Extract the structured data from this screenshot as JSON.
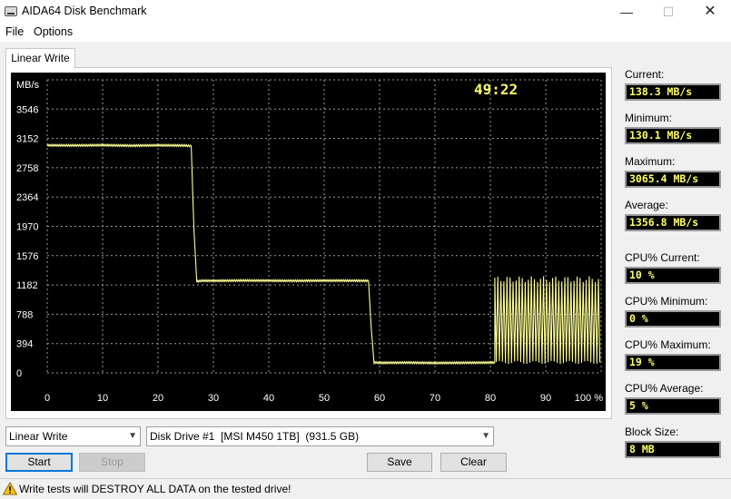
{
  "window": {
    "title": "AIDA64 Disk Benchmark",
    "minimize_glyph": "—",
    "maximize_glyph": "☐",
    "close_glyph": "✕",
    "icon": "disk-benchmark-icon"
  },
  "menu": {
    "file": "File",
    "options": "Options"
  },
  "tab": {
    "label": "Linear Write"
  },
  "chart": {
    "timer": "49:22",
    "ylabel": "MB/s",
    "timer_color": "#ffff66",
    "line_color": "#ffff99",
    "grid_color": "#9a9a9a",
    "background": "#000000"
  },
  "chart_data": {
    "type": "line",
    "title": "",
    "xlabel": "",
    "ylabel": "MB/s",
    "x_ticks": [
      "0",
      "10",
      "20",
      "30",
      "40",
      "50",
      "60",
      "70",
      "80",
      "90",
      "100 %"
    ],
    "y_ticks": [
      "0",
      "394",
      "788",
      "1182",
      "1576",
      "1970",
      "2364",
      "2758",
      "3152",
      "3546"
    ],
    "xlim": [
      0,
      100
    ],
    "ylim": [
      0,
      3940
    ],
    "grid": true,
    "series": [
      {
        "x": [
          0,
          5,
          10,
          15,
          20,
          25,
          26,
          26.5,
          27,
          28,
          30,
          35,
          40,
          45,
          50,
          55,
          58,
          58.5,
          59,
          60,
          65,
          70,
          75,
          80,
          80.8
        ],
        "y": [
          3060,
          3058,
          3062,
          3055,
          3060,
          3057,
          3050,
          1900,
          1230,
          1240,
          1238,
          1242,
          1240,
          1238,
          1241,
          1240,
          1238,
          600,
          140,
          135,
          138,
          133,
          136,
          138,
          140
        ]
      }
    ],
    "oscillation": {
      "x_range": [
        80.8,
        100
      ],
      "y_min": 140,
      "y_max": 1260,
      "description_period_pct": 0.55
    }
  },
  "stats": {
    "current_label": "Current:",
    "current_value": "138.3 MB/s",
    "minimum_label": "Minimum:",
    "minimum_value": "130.1 MB/s",
    "maximum_label": "Maximum:",
    "maximum_value": "3065.4 MB/s",
    "average_label": "Average:",
    "average_value": "1356.8 MB/s",
    "cpu_current_label": "CPU% Current:",
    "cpu_current_value": "10 %",
    "cpu_minimum_label": "CPU% Minimum:",
    "cpu_minimum_value": "0 %",
    "cpu_maximum_label": "CPU% Maximum:",
    "cpu_maximum_value": "19 %",
    "cpu_average_label": "CPU% Average:",
    "cpu_average_value": "5 %",
    "block_size_label": "Block Size:",
    "block_size_value": "8 MB"
  },
  "controls": {
    "test_select": "Linear Write",
    "drive_select": "Disk Drive #1  [MSI M450 1TB]  (931.5 GB)",
    "start": "Start",
    "stop": "Stop",
    "save": "Save",
    "clear": "Clear"
  },
  "status": {
    "text": "Write tests will DESTROY ALL DATA on the tested drive!",
    "icon": "warning-icon"
  }
}
